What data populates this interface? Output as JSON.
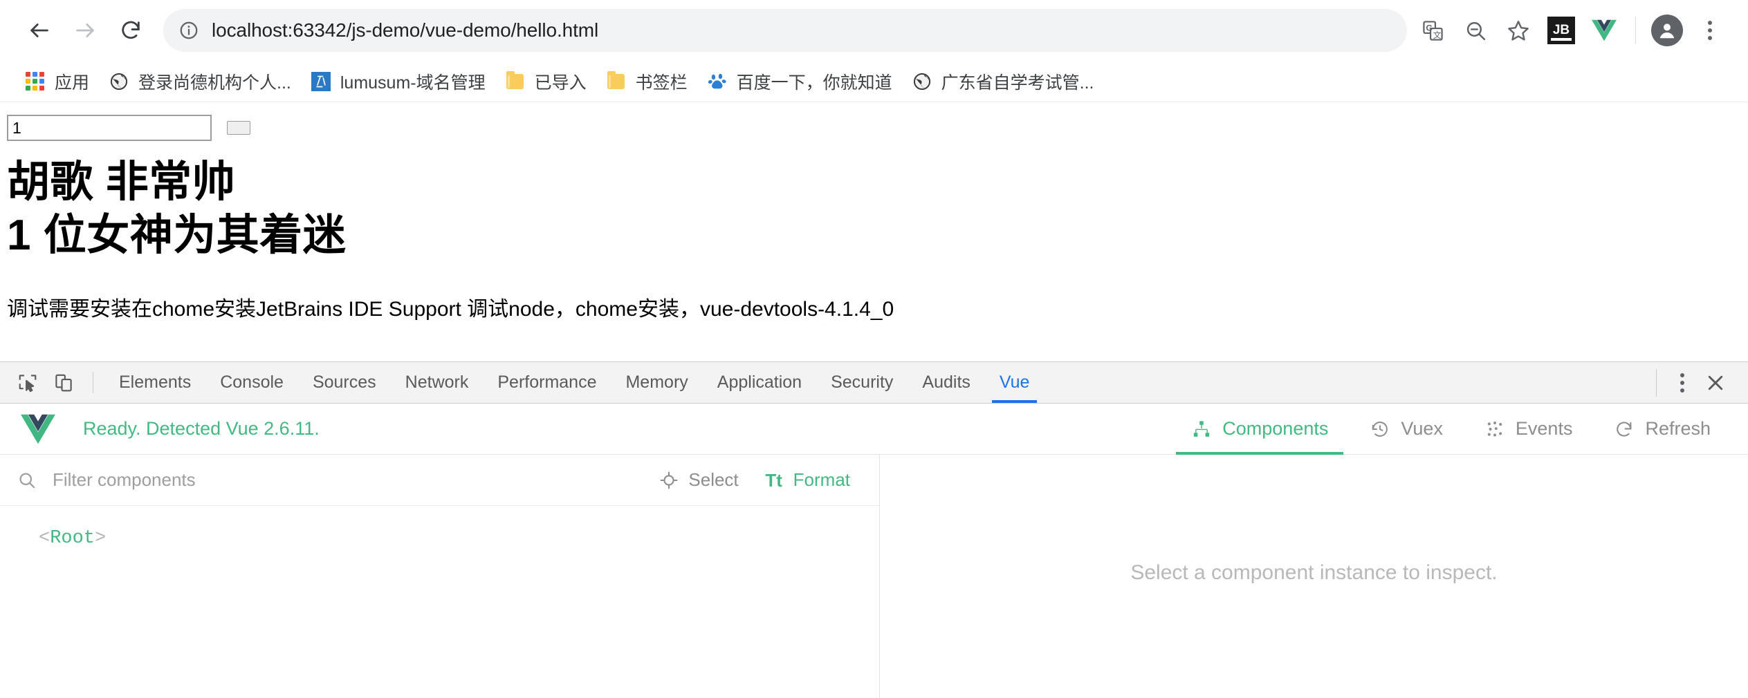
{
  "browser": {
    "back_label": "Back",
    "forward_label": "Forward",
    "reload_label": "Reload",
    "url_display": "localhost:63342/js-demo/vue-demo/hello.html",
    "url_host": "localhost",
    "url_path": ":63342/js-demo/vue-demo/hello.html",
    "toolbar_icons": [
      {
        "name": "translate-icon",
        "label": "Translate this page"
      },
      {
        "name": "zoom-out-icon",
        "label": "Zoom out"
      },
      {
        "name": "bookmark-star-icon",
        "label": "Bookmark this page"
      },
      {
        "name": "jetbrains-extension-icon",
        "label": "JB"
      },
      {
        "name": "vue-extension-icon",
        "label": "Vue.js devtools"
      },
      {
        "name": "profile-avatar",
        "label": "Profile"
      },
      {
        "name": "chrome-menu-icon",
        "label": "Customize and control Google Chrome"
      }
    ],
    "bookmarks": [
      {
        "label": "应用",
        "icon": "apps-grid-icon"
      },
      {
        "label": "登录尚德机构个人...",
        "icon": "globe-icon"
      },
      {
        "label": "lumusum-域名管理",
        "icon": "jetbrains-site-icon"
      },
      {
        "label": "已导入",
        "icon": "folder-icon"
      },
      {
        "label": "书签栏",
        "icon": "folder-icon"
      },
      {
        "label": "百度一下，你就知道",
        "icon": "baidu-icon"
      },
      {
        "label": "广东省自学考试管...",
        "icon": "globe-icon"
      }
    ]
  },
  "page": {
    "input_value": "1",
    "input_placeholder": "",
    "button_label": "",
    "heading_line1": "胡歌 非常帅",
    "heading_line2": "1 位女神为其着迷",
    "paragraph": "调试需要安装在chome安装JetBrains IDE Support 调试node，chome安装，vue-devtools-4.1.4_0"
  },
  "devtools": {
    "inspect_icon_label": "Inspect element",
    "device_toolbar_icon_label": "Toggle device toolbar",
    "tabs": [
      {
        "label": "Elements",
        "active": false
      },
      {
        "label": "Console",
        "active": false
      },
      {
        "label": "Sources",
        "active": false
      },
      {
        "label": "Network",
        "active": false
      },
      {
        "label": "Performance",
        "active": false
      },
      {
        "label": "Memory",
        "active": false
      },
      {
        "label": "Application",
        "active": false
      },
      {
        "label": "Security",
        "active": false
      },
      {
        "label": "Audits",
        "active": false
      },
      {
        "label": "Vue",
        "active": true
      }
    ],
    "more_options_label": "More options",
    "close_label": "Close DevTools",
    "active_tab_color": "#1a73e8"
  },
  "vue_panel": {
    "status_text": "Ready. Detected Vue 2.6.11.",
    "accent_color": "#42b983",
    "nav": [
      {
        "label": "Components",
        "icon": "components-tree-icon",
        "active": true
      },
      {
        "label": "Vuex",
        "icon": "history-clock-icon",
        "active": false
      },
      {
        "label": "Events",
        "icon": "events-dots-icon",
        "active": false
      },
      {
        "label": "Refresh",
        "icon": "refresh-icon",
        "active": false
      }
    ],
    "filter_placeholder": "Filter components",
    "filter_value": "",
    "select_label": "Select",
    "format_label": "Format",
    "format_icon_label": "Tt",
    "tree": [
      {
        "open_angle": "<",
        "name": "Root",
        "close_angle": ">"
      }
    ],
    "empty_state": "Select a component instance to inspect."
  }
}
